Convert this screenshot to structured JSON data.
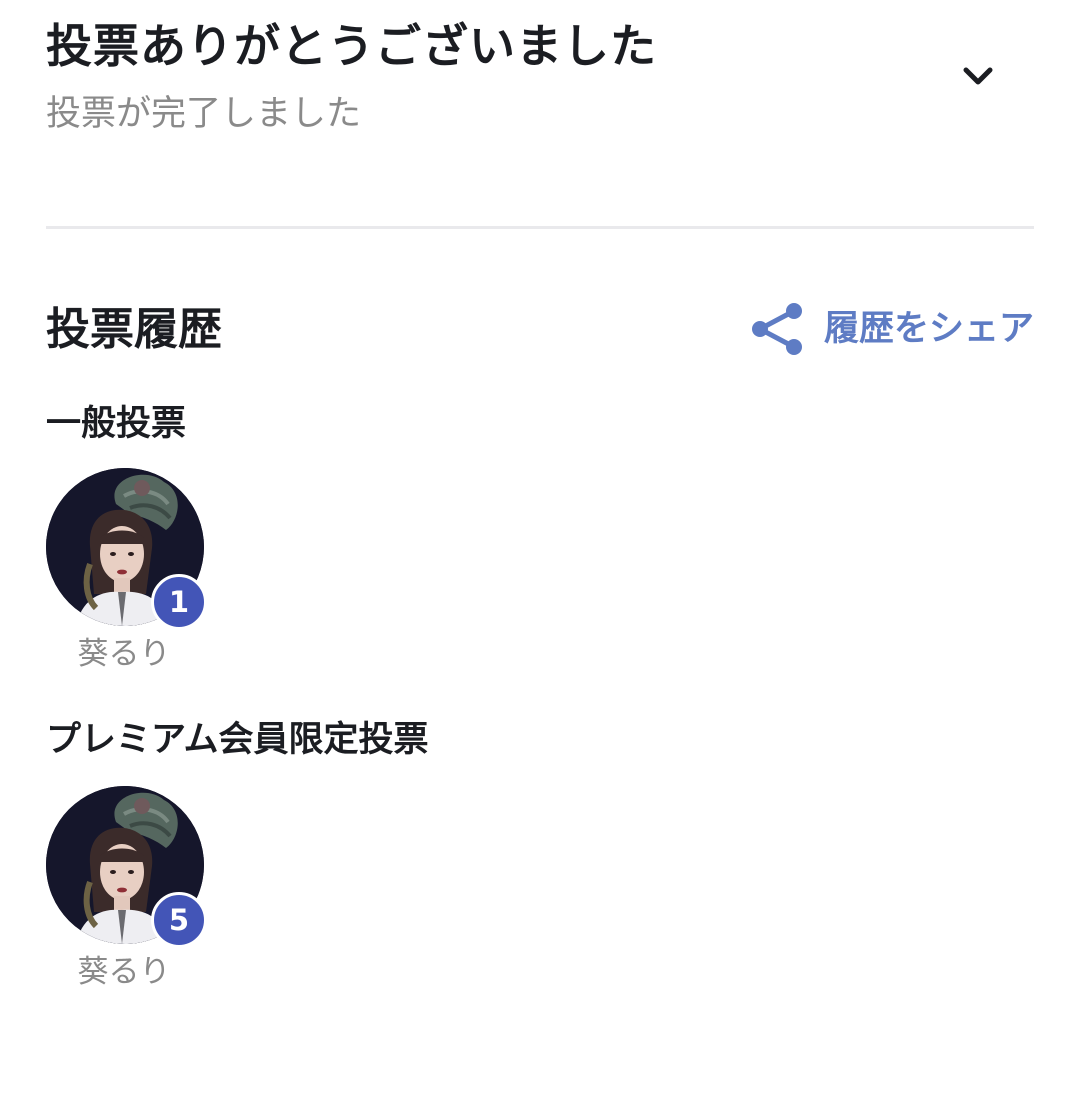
{
  "header": {
    "title": "投票ありがとうございました",
    "subtitle": "投票が完了しました",
    "collapse_icon": "chevron-down-icon"
  },
  "history": {
    "title": "投票履歴",
    "share_label": "履歴をシェア",
    "share_icon": "share-icon",
    "accent_color": "#5e7cc4",
    "badge_color": "#4355b7"
  },
  "groups": [
    {
      "title": "一般投票",
      "candidates": [
        {
          "name": "葵るり",
          "votes": "1"
        }
      ]
    },
    {
      "title": "プレミアム会員限定投票",
      "candidates": [
        {
          "name": "葵るり",
          "votes": "5"
        }
      ]
    }
  ]
}
